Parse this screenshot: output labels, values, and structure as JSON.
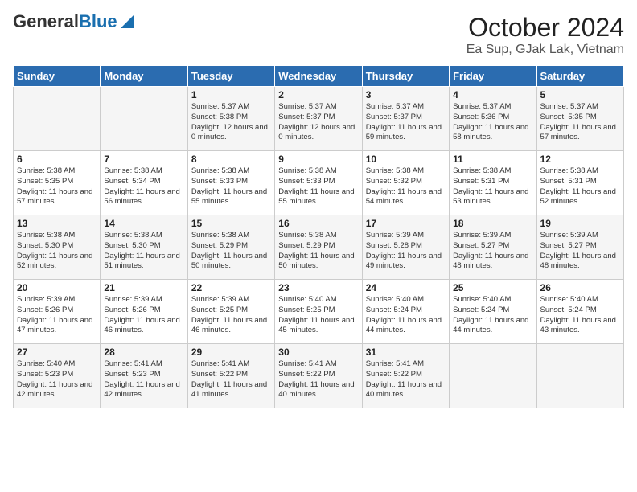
{
  "header": {
    "logo_general": "General",
    "logo_blue": "Blue",
    "title": "October 2024",
    "subtitle": "Ea Sup, GJak Lak, Vietnam"
  },
  "weekdays": [
    "Sunday",
    "Monday",
    "Tuesday",
    "Wednesday",
    "Thursday",
    "Friday",
    "Saturday"
  ],
  "weeks": [
    [
      {
        "day": "",
        "sunrise": "",
        "sunset": "",
        "daylight": ""
      },
      {
        "day": "",
        "sunrise": "",
        "sunset": "",
        "daylight": ""
      },
      {
        "day": "1",
        "sunrise": "Sunrise: 5:37 AM",
        "sunset": "Sunset: 5:38 PM",
        "daylight": "Daylight: 12 hours and 0 minutes."
      },
      {
        "day": "2",
        "sunrise": "Sunrise: 5:37 AM",
        "sunset": "Sunset: 5:37 PM",
        "daylight": "Daylight: 12 hours and 0 minutes."
      },
      {
        "day": "3",
        "sunrise": "Sunrise: 5:37 AM",
        "sunset": "Sunset: 5:37 PM",
        "daylight": "Daylight: 11 hours and 59 minutes."
      },
      {
        "day": "4",
        "sunrise": "Sunrise: 5:37 AM",
        "sunset": "Sunset: 5:36 PM",
        "daylight": "Daylight: 11 hours and 58 minutes."
      },
      {
        "day": "5",
        "sunrise": "Sunrise: 5:37 AM",
        "sunset": "Sunset: 5:35 PM",
        "daylight": "Daylight: 11 hours and 57 minutes."
      }
    ],
    [
      {
        "day": "6",
        "sunrise": "Sunrise: 5:38 AM",
        "sunset": "Sunset: 5:35 PM",
        "daylight": "Daylight: 11 hours and 57 minutes."
      },
      {
        "day": "7",
        "sunrise": "Sunrise: 5:38 AM",
        "sunset": "Sunset: 5:34 PM",
        "daylight": "Daylight: 11 hours and 56 minutes."
      },
      {
        "day": "8",
        "sunrise": "Sunrise: 5:38 AM",
        "sunset": "Sunset: 5:33 PM",
        "daylight": "Daylight: 11 hours and 55 minutes."
      },
      {
        "day": "9",
        "sunrise": "Sunrise: 5:38 AM",
        "sunset": "Sunset: 5:33 PM",
        "daylight": "Daylight: 11 hours and 55 minutes."
      },
      {
        "day": "10",
        "sunrise": "Sunrise: 5:38 AM",
        "sunset": "Sunset: 5:32 PM",
        "daylight": "Daylight: 11 hours and 54 minutes."
      },
      {
        "day": "11",
        "sunrise": "Sunrise: 5:38 AM",
        "sunset": "Sunset: 5:31 PM",
        "daylight": "Daylight: 11 hours and 53 minutes."
      },
      {
        "day": "12",
        "sunrise": "Sunrise: 5:38 AM",
        "sunset": "Sunset: 5:31 PM",
        "daylight": "Daylight: 11 hours and 52 minutes."
      }
    ],
    [
      {
        "day": "13",
        "sunrise": "Sunrise: 5:38 AM",
        "sunset": "Sunset: 5:30 PM",
        "daylight": "Daylight: 11 hours and 52 minutes."
      },
      {
        "day": "14",
        "sunrise": "Sunrise: 5:38 AM",
        "sunset": "Sunset: 5:30 PM",
        "daylight": "Daylight: 11 hours and 51 minutes."
      },
      {
        "day": "15",
        "sunrise": "Sunrise: 5:38 AM",
        "sunset": "Sunset: 5:29 PM",
        "daylight": "Daylight: 11 hours and 50 minutes."
      },
      {
        "day": "16",
        "sunrise": "Sunrise: 5:38 AM",
        "sunset": "Sunset: 5:29 PM",
        "daylight": "Daylight: 11 hours and 50 minutes."
      },
      {
        "day": "17",
        "sunrise": "Sunrise: 5:39 AM",
        "sunset": "Sunset: 5:28 PM",
        "daylight": "Daylight: 11 hours and 49 minutes."
      },
      {
        "day": "18",
        "sunrise": "Sunrise: 5:39 AM",
        "sunset": "Sunset: 5:27 PM",
        "daylight": "Daylight: 11 hours and 48 minutes."
      },
      {
        "day": "19",
        "sunrise": "Sunrise: 5:39 AM",
        "sunset": "Sunset: 5:27 PM",
        "daylight": "Daylight: 11 hours and 48 minutes."
      }
    ],
    [
      {
        "day": "20",
        "sunrise": "Sunrise: 5:39 AM",
        "sunset": "Sunset: 5:26 PM",
        "daylight": "Daylight: 11 hours and 47 minutes."
      },
      {
        "day": "21",
        "sunrise": "Sunrise: 5:39 AM",
        "sunset": "Sunset: 5:26 PM",
        "daylight": "Daylight: 11 hours and 46 minutes."
      },
      {
        "day": "22",
        "sunrise": "Sunrise: 5:39 AM",
        "sunset": "Sunset: 5:25 PM",
        "daylight": "Daylight: 11 hours and 46 minutes."
      },
      {
        "day": "23",
        "sunrise": "Sunrise: 5:40 AM",
        "sunset": "Sunset: 5:25 PM",
        "daylight": "Daylight: 11 hours and 45 minutes."
      },
      {
        "day": "24",
        "sunrise": "Sunrise: 5:40 AM",
        "sunset": "Sunset: 5:24 PM",
        "daylight": "Daylight: 11 hours and 44 minutes."
      },
      {
        "day": "25",
        "sunrise": "Sunrise: 5:40 AM",
        "sunset": "Sunset: 5:24 PM",
        "daylight": "Daylight: 11 hours and 44 minutes."
      },
      {
        "day": "26",
        "sunrise": "Sunrise: 5:40 AM",
        "sunset": "Sunset: 5:24 PM",
        "daylight": "Daylight: 11 hours and 43 minutes."
      }
    ],
    [
      {
        "day": "27",
        "sunrise": "Sunrise: 5:40 AM",
        "sunset": "Sunset: 5:23 PM",
        "daylight": "Daylight: 11 hours and 42 minutes."
      },
      {
        "day": "28",
        "sunrise": "Sunrise: 5:41 AM",
        "sunset": "Sunset: 5:23 PM",
        "daylight": "Daylight: 11 hours and 42 minutes."
      },
      {
        "day": "29",
        "sunrise": "Sunrise: 5:41 AM",
        "sunset": "Sunset: 5:22 PM",
        "daylight": "Daylight: 11 hours and 41 minutes."
      },
      {
        "day": "30",
        "sunrise": "Sunrise: 5:41 AM",
        "sunset": "Sunset: 5:22 PM",
        "daylight": "Daylight: 11 hours and 40 minutes."
      },
      {
        "day": "31",
        "sunrise": "Sunrise: 5:41 AM",
        "sunset": "Sunset: 5:22 PM",
        "daylight": "Daylight: 11 hours and 40 minutes."
      },
      {
        "day": "",
        "sunrise": "",
        "sunset": "",
        "daylight": ""
      },
      {
        "day": "",
        "sunrise": "",
        "sunset": "",
        "daylight": ""
      }
    ]
  ]
}
